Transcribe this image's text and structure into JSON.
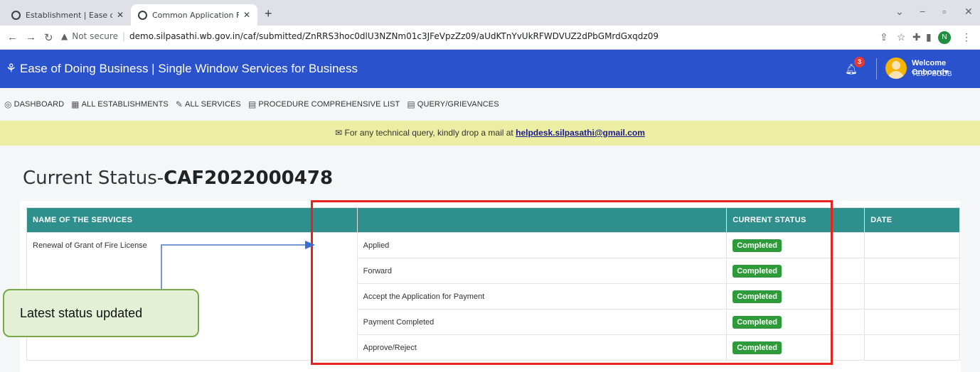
{
  "browser": {
    "tabs": [
      {
        "label": "Establishment | Ease of doing bu"
      },
      {
        "label": "Common Application Form Previ"
      }
    ],
    "url_security": "Not secure",
    "url": "demo.silpasathi.wb.gov.in/caf/submitted/ZnRRS3hoc0dlU3NZNm01c3JFeVpzZz09/aUdKTnYvUkRFWDVUZ2dPbGMrdGxqdz09",
    "profile_initial": "N"
  },
  "header": {
    "title": "Ease of Doing Business | Single Window Services for Business",
    "notification_count": "3",
    "welcome": "Welcome Onboard",
    "username": "TEST EODB"
  },
  "menu": {
    "items": [
      {
        "label": "DASHBOARD"
      },
      {
        "label": "ALL ESTABLISHMENTS"
      },
      {
        "label": "ALL SERVICES"
      },
      {
        "label": "PROCEDURE COMPREHENSIVE LIST"
      },
      {
        "label": "QUERY/GRIEVANCES"
      }
    ]
  },
  "notice": {
    "text": "For any technical query, kindly drop a mail at",
    "email": "helpdesk.silpasathi@gmail.com"
  },
  "page": {
    "title_prefix": "Current Status-",
    "caf_id": "CAF2022000478"
  },
  "table": {
    "headers": {
      "services": "NAME OF THE SERVICES",
      "step": "",
      "status": "CURRENT STATUS",
      "date": "DATE"
    },
    "service_name": "Renewal of Grant of Fire License",
    "rows": [
      {
        "step": "Applied",
        "status": "Completed",
        "date": ""
      },
      {
        "step": "Forward",
        "status": "Completed",
        "date": ""
      },
      {
        "step": "Accept the Application for Payment",
        "status": "Completed",
        "date": ""
      },
      {
        "step": "Payment Completed",
        "status": "Completed",
        "date": ""
      },
      {
        "step": "Approve/Reject",
        "status": "Completed",
        "date": ""
      }
    ]
  },
  "annotation": {
    "callout": "Latest status updated"
  },
  "colors": {
    "header_blue": "#2a52cc",
    "table_header_teal": "#2f8f8c",
    "status_green": "#2e9a3a",
    "notice_yellow": "#ecefa3",
    "highlight_red": "#e8231f"
  }
}
